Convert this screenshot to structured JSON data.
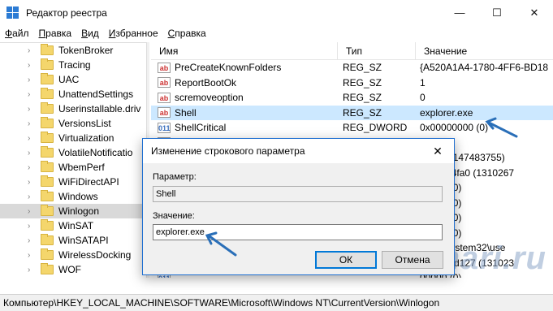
{
  "window": {
    "title": "Редактор реестра",
    "minimize_glyph": "—",
    "maximize_glyph": "☐",
    "close_glyph": "✕"
  },
  "menu": [
    "Файл",
    "Правка",
    "Вид",
    "Избранное",
    "Справка"
  ],
  "tree": {
    "items": [
      {
        "label": "TokenBroker"
      },
      {
        "label": "Tracing"
      },
      {
        "label": "UAC"
      },
      {
        "label": "UnattendSettings"
      },
      {
        "label": "Userinstallable.driv"
      },
      {
        "label": "VersionsList"
      },
      {
        "label": "Virtualization"
      },
      {
        "label": "VolatileNotificatio"
      },
      {
        "label": "WbemPerf"
      },
      {
        "label": "WiFiDirectAPI"
      },
      {
        "label": "Windows"
      },
      {
        "label": "Winlogon",
        "selected": true
      },
      {
        "label": "WinSAT"
      },
      {
        "label": "WinSATAPI"
      },
      {
        "label": "WirelessDocking"
      },
      {
        "label": "WOF"
      }
    ]
  },
  "list": {
    "headers": {
      "name": "Имя",
      "type": "Тип",
      "value": "Значение"
    },
    "rows": [
      {
        "icon": "ab",
        "name": "PreCreateKnownFolders",
        "type": "REG_SZ",
        "value": "{A520A1A4-1780-4FF6-BD18"
      },
      {
        "icon": "ab",
        "name": "ReportBootOk",
        "type": "REG_SZ",
        "value": "1"
      },
      {
        "icon": "ab",
        "name": "scremoveoption",
        "type": "REG_SZ",
        "value": "0"
      },
      {
        "icon": "ab",
        "name": "Shell",
        "type": "REG_SZ",
        "value": "explorer.exe",
        "selected": true
      },
      {
        "icon": "bin",
        "name": "ShellCritical",
        "type": "REG_DWORD",
        "value": "0x00000000 (0)"
      },
      {
        "icon": "ab",
        "name": "",
        "type": "",
        "value": "exe"
      },
      {
        "icon": "bin",
        "name": "",
        "type": "",
        "value": "006b (2147483755)"
      },
      {
        "icon": "bin",
        "name": "",
        "type": "",
        "value": "f7f74cc4fa0 (1310267"
      },
      {
        "icon": "bin",
        "name": "",
        "type": "",
        "value": "00000 (0)"
      },
      {
        "icon": "bin",
        "name": "",
        "type": "",
        "value": "00000 (0)"
      },
      {
        "icon": "bin",
        "name": "",
        "type": "",
        "value": "00000 (0)"
      },
      {
        "icon": "bin",
        "name": "",
        "type": "",
        "value": "00000 (0)"
      },
      {
        "icon": "ab",
        "name": "",
        "type": "",
        "value": "dows\\system32\\use"
      },
      {
        "icon": "bin",
        "name": "",
        "type": "",
        "value": "cfc32e4d127 (131023"
      },
      {
        "icon": "bin",
        "name": "",
        "type": "",
        "value": "00000 (0)"
      }
    ]
  },
  "dialog": {
    "title": "Изменение строкового параметра",
    "close_glyph": "✕",
    "param_label": "Параметр:",
    "param_value": "Shell",
    "value_label": "Значение:",
    "value_value": "explorer.exe",
    "ok_label": "ОК",
    "cancel_label": "Отмена"
  },
  "status": "Компьютер\\HKEY_LOCAL_MACHINE\\SOFTWARE\\Microsoft\\Windows NT\\CurrentVersion\\Winlogon",
  "watermark": "tehnari.ru",
  "colors": {
    "selection": "#cce8ff",
    "arrow": "#2a6fb8",
    "folder": "#f4d66c"
  }
}
